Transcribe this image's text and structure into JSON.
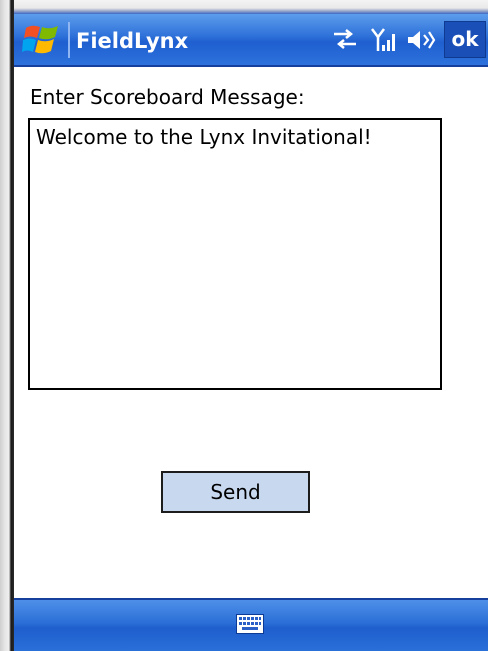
{
  "window": {
    "title": "FieldLynx",
    "ok_label": "ok",
    "tray_icons": [
      "connectivity-icon",
      "signal-strength-icon",
      "volume-icon"
    ]
  },
  "form": {
    "prompt_label": "Enter Scoreboard Message:",
    "message_value": "Welcome to the Lynx Invitational!",
    "send_label": "Send"
  },
  "bottom_bar": {
    "icon": "keyboard-icon"
  },
  "colors": {
    "titlebar": "#2c6fd8",
    "send_button_bg": "#c8d8ee",
    "text": "#000000"
  }
}
